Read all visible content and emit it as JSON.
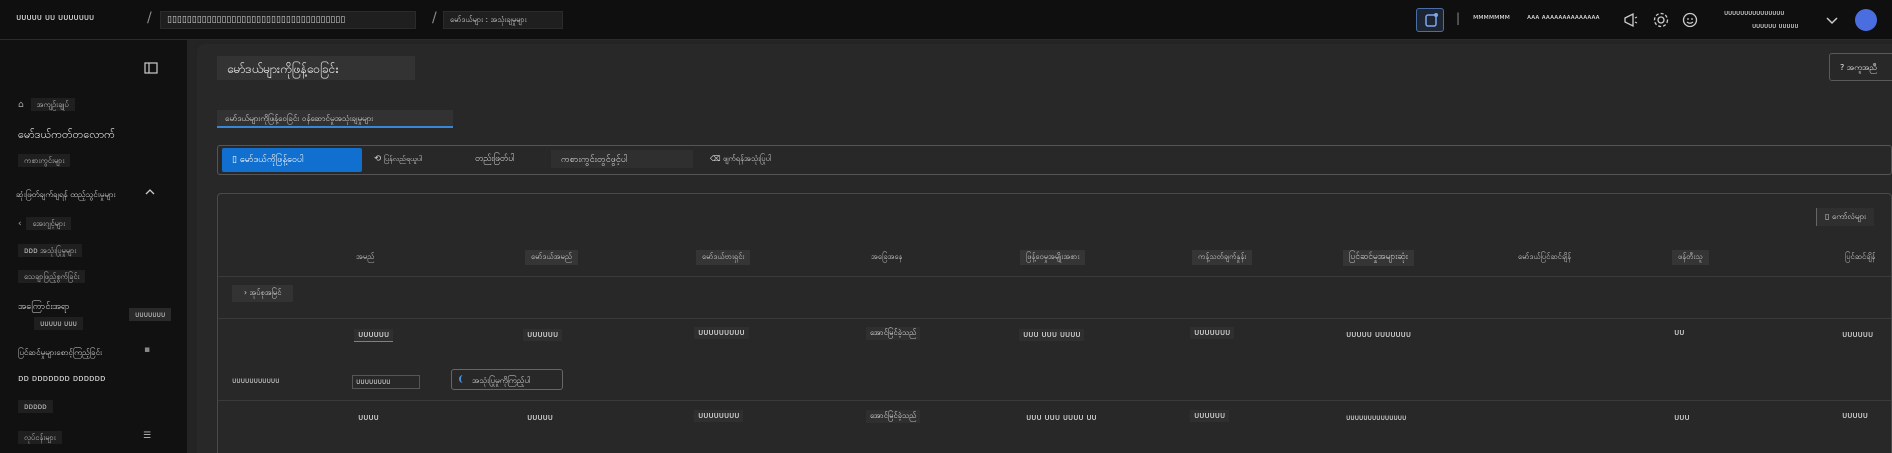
{
  "header": {
    "brand": "ᴜᴜᴜᴜᴜ ᴜᴜ ᴜᴜᴜᴜᴜᴜᴜ",
    "breadcrumb_1": "▯▯▯▯▯▯▯▯▯▯▯▯▯▯▯▯▯▯▯▯▯▯▯▯▯▯▯▯▯▯▯▯▯▯▯▯",
    "breadcrumb_2": "မော်ဒယ်များ : အသုံးချမှုများ",
    "directory": "ᴍᴍᴍᴍᴍᴍᴍ",
    "subscription": "ᴀᴀᴀ ᴀᴀᴀᴀᴀᴀᴀᴀᴀᴀᴀᴀᴀᴀ",
    "user_line1": "ᴜᴜᴜᴜᴜᴜᴜᴜᴜᴜᴜᴜᴜᴜᴜ",
    "user_line2": "ᴜᴜᴜᴜᴜᴜ ᴜᴜᴜᴜᴜ",
    "icons": [
      "copilot-icon",
      "megaphone-icon",
      "gear-icon",
      "smiley-icon",
      "chevron-down-icon",
      "avatar"
    ]
  },
  "sidebar": {
    "items": [
      {
        "label": "အကျဉ်းချုပ်",
        "icon": "home-icon"
      },
      {
        "label": "မော်ဒယ်ကတ်တလောက်"
      },
      {
        "label": "ကစားကွင်းများ"
      },
      {
        "label": "ဆုံးဖြတ်ချက်ချရန် ထည့်သွင်းမှုများ"
      },
      {
        "label": "အေးဂျင့်များ",
        "icon": "agent-icon"
      },
      {
        "label": "ᴅᴅᴅ အသုံးပြုမှုများ"
      },
      {
        "label": "သေချာဖြည့်စွက်ခြင်း"
      },
      {
        "label": "အကြောင်းအရာ",
        "sub": "ᴜᴜᴜᴜᴜ ᴜᴜᴜ",
        "badge": "ᴜᴜᴜᴜᴜᴜᴜ"
      },
      {
        "label": "ပြင်ဆင်မှုများစောင့်ကြည့်ခြင်း"
      },
      {
        "label": "ᴅᴅ ᴅᴅᴅᴅᴅᴅᴅ ᴅᴅᴅᴅᴅᴅ"
      },
      {
        "label": "ᴅᴅᴅᴅᴅ"
      },
      {
        "label": "လုပ်ငန်းများ"
      }
    ],
    "collapse_label": "‹"
  },
  "main": {
    "title": "မော်ဒယ်များကိုဖြန့်ဝေခြင်း",
    "top_right_button": "? အကူအညီ",
    "tab": "မော်ဒယ်များကိုဖြန့်ဝေခြင်း ဝန်ဆောင်မှုအသုံးချမှုများ",
    "commands": {
      "deploy": "မော်ဒယ်ကိုဖြန့်ဝေပါ",
      "refresh": "ပြန်လည်ရယူပါ",
      "edit": "တည်းဖြတ်ပါ",
      "open_playground": "ကစားကွင်းတွင်ဖွင့်ပါ",
      "delete": "ဖျက်ရန်အသုံးပြုပါ"
    },
    "columns_button": "ကော်လံများ",
    "columns": [
      "အမည်",
      "မော်ဒယ်အမည်",
      "မော်ဒယ်ဗားရှင်း",
      "အခြေအနေ",
      "ဖြန့်ဝေမှုအမျိုးအစား",
      "ကန့်သတ်ချက်နှုန်း",
      "ပြင်ဆင်မှုအများဆုံး",
      "မော်ဒယ်ပြင်ဆင်ချိန်",
      "ဖန်တီးသူ",
      "ပြင်ဆင်ချိန်"
    ],
    "group_label": "အုပ်စုအမြင်",
    "rows": [
      {
        "name": "ᴜᴜᴜᴜᴜᴜ",
        "model": "ᴜᴜᴜᴜᴜᴜ",
        "version": "ᴜᴜᴜᴜᴜᴜᴜᴜᴜ",
        "state": "အောင်မြင်ခဲ့သည်",
        "type": "ᴜᴜᴜ ᴜᴜᴜ ᴜᴜᴜᴜ",
        "rate": "ᴜᴜᴜᴜᴜᴜᴜ",
        "max": "ᴜᴜᴜᴜᴜ ᴜᴜᴜᴜᴜᴜᴜ",
        "creator": "ᴜᴜ",
        "updated": "ᴜᴜᴜᴜᴜᴜ"
      },
      {
        "name": "ᴜᴜᴜᴜ",
        "model": "ᴜᴜᴜᴜᴜ",
        "version": "ᴜᴜᴜᴜᴜᴜᴜᴜ",
        "state": "အောင်မြင်ခဲ့သည်",
        "type": "ᴜᴜᴜ ᴜᴜᴜ ᴜᴜᴜᴜ ᴜᴜ",
        "rate": "ᴜᴜᴜᴜᴜᴜ",
        "max": "ᴜᴜᴜᴜᴜᴜᴜᴜᴜᴜᴜᴜᴜᴜ",
        "creator": "ᴜᴜᴜ",
        "updated": "ᴜᴜᴜᴜᴜ"
      }
    ],
    "inline_row": {
      "label": "ᴜᴜᴜᴜᴜᴜᴜᴜᴜᴜᴜ",
      "input": "ᴜᴜᴜᴜᴜᴜᴜᴜ",
      "button": "အသုံးပြုမှုကိုကြည့်ပါ"
    }
  },
  "colors": {
    "accent": "#1170cf",
    "avatar": "#4a6ee0",
    "bg": "#1b1b1b"
  }
}
